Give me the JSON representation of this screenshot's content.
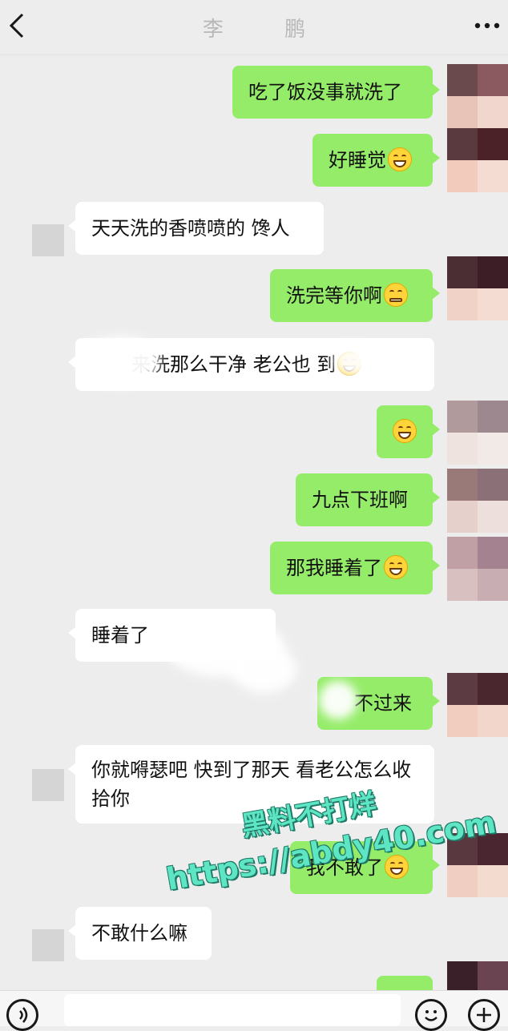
{
  "header": {
    "title": "李 鹏"
  },
  "messages": [
    {
      "side": "me",
      "text": "吃了饭没事就洗了"
    },
    {
      "side": "me",
      "text": "好睡觉"
    },
    {
      "side": "other",
      "text": "天天洗的香喷喷的 馋人"
    },
    {
      "side": "me",
      "text": "洗完等你啊"
    },
    {
      "side": "other",
      "text": "来洗那么干净 老公也 到"
    },
    {
      "side": "me",
      "text": ""
    },
    {
      "side": "me",
      "text": "九点下班啊"
    },
    {
      "side": "me",
      "text": "那我睡着了"
    },
    {
      "side": "other",
      "text": "睡着了"
    },
    {
      "side": "me",
      "text": "不过来"
    },
    {
      "side": "other",
      "text": "你就嘚瑟吧 快到了那天 看老公怎么收拾你"
    },
    {
      "side": "me",
      "text": "我不敢了"
    },
    {
      "side": "other",
      "text": "不敢什么嘛"
    }
  ],
  "watermark": {
    "line1": "黑料不打烊",
    "line2": "https://abdy40.com"
  },
  "colors": {
    "background": "#ededed",
    "my_bubble": "#95ec69",
    "other_bubble": "#ffffff",
    "watermark": "#5ee5c4"
  },
  "icons": {
    "back": "chevron-left-icon",
    "more": "more-dots-icon",
    "voice": "voice-icon",
    "emoji": "emoji-icon",
    "plus": "plus-icon"
  }
}
